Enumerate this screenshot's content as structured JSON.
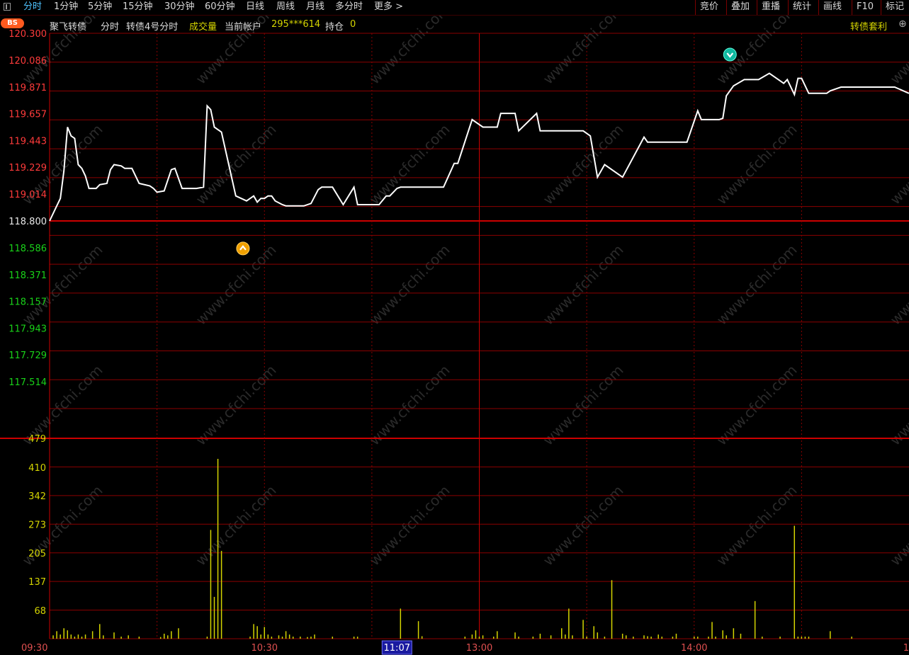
{
  "toolbar": {
    "tabs": [
      "分时",
      "1分钟",
      "5分钟",
      "15分钟",
      "30分钟",
      "60分钟",
      "日线",
      "周线",
      "月线",
      "多分时",
      "更多 >"
    ],
    "active_tab": "分时",
    "right_buttons": [
      "竞价",
      "叠加",
      "重播",
      "统计",
      "画线",
      "F10",
      "标记"
    ]
  },
  "infobar": {
    "badge": "BS",
    "stock_name": "聚飞转债",
    "mode": "分时",
    "layout": "转债4号分时",
    "volume_label": "成交量",
    "account_label": "当前帐户",
    "account_id": "295***614",
    "position_label": "持仓",
    "position_value": "0",
    "arbitrage": "转债套利"
  },
  "colors": {
    "background": "#000000",
    "grid": "#8b0000",
    "price_line": "#ffffff",
    "up_label": "#ff3b3b",
    "down_label": "#19d219",
    "volume_bar": "#d4d400",
    "active_tab": "#4fc3ff"
  },
  "watermark": "www.cfchi.com",
  "chart_data": [
    {
      "type": "line",
      "name": "price",
      "prev_close": 118.8,
      "ylim": [
        117.3,
        120.3
      ],
      "y_tick_labels_up": [
        "120.300",
        "120.086",
        "119.871",
        "119.657",
        "119.443",
        "119.229",
        "119.014"
      ],
      "y_tick_mid": "118.800",
      "y_tick_labels_down": [
        "118.586",
        "118.371",
        "118.157",
        "117.943",
        "117.729",
        "117.514"
      ],
      "x_tick_labels": [
        "09:30",
        "10:30",
        "11:07",
        "13:00",
        "14:00",
        "1"
      ],
      "x_total_minutes": 240,
      "x": [
        0,
        2,
        3,
        4,
        5,
        6,
        7,
        8,
        9,
        10,
        11,
        13,
        14,
        16,
        17,
        18,
        20,
        21,
        23,
        25,
        28,
        29,
        30,
        32,
        34,
        35,
        37,
        39,
        41,
        43,
        44,
        45,
        46,
        48,
        52,
        55,
        57,
        58,
        59,
        60,
        61,
        62,
        63,
        65,
        66,
        68,
        71,
        73,
        75,
        76,
        79,
        82,
        85,
        86,
        87,
        88,
        92,
        94,
        95,
        96,
        97,
        98,
        100,
        102,
        106,
        110,
        113,
        114,
        118,
        121,
        125,
        126,
        130,
        131,
        136,
        137,
        139,
        141,
        143,
        146,
        149,
        151,
        153,
        155,
        160,
        166,
        167,
        170,
        172,
        174,
        178,
        181,
        182,
        186,
        187,
        188,
        189,
        191,
        194,
        198,
        201,
        204,
        205,
        206,
        208,
        209,
        210,
        212,
        213,
        216,
        217,
        218,
        221,
        222,
        224,
        226,
        230,
        236,
        240
      ],
      "y": [
        118.8,
        118.92,
        118.98,
        119.2,
        119.55,
        119.48,
        119.46,
        119.25,
        119.22,
        119.16,
        119.06,
        119.06,
        119.09,
        119.1,
        119.21,
        119.25,
        119.24,
        119.22,
        119.22,
        119.1,
        119.08,
        119.06,
        119.03,
        119.04,
        119.21,
        119.22,
        119.06,
        119.06,
        119.06,
        119.07,
        119.72,
        119.69,
        119.55,
        119.51,
        119.0,
        118.96,
        119.0,
        118.95,
        118.98,
        118.98,
        119.0,
        119.0,
        118.96,
        118.93,
        118.92,
        118.92,
        118.92,
        118.94,
        119.05,
        119.07,
        119.07,
        118.93,
        119.07,
        118.93,
        118.93,
        118.93,
        118.93,
        119.0,
        119.0,
        119.03,
        119.06,
        119.07,
        119.07,
        119.07,
        119.07,
        119.07,
        119.26,
        119.26,
        119.61,
        119.55,
        119.55,
        119.66,
        119.66,
        119.52,
        119.66,
        119.52,
        119.52,
        119.52,
        119.52,
        119.52,
        119.52,
        119.48,
        119.15,
        119.25,
        119.15,
        119.47,
        119.43,
        119.43,
        119.43,
        119.43,
        119.43,
        119.68,
        119.61,
        119.61,
        119.61,
        119.62,
        119.8,
        119.88,
        119.93,
        119.93,
        119.98,
        119.92,
        119.9,
        119.93,
        119.81,
        119.94,
        119.94,
        119.82,
        119.82,
        119.82,
        119.82,
        119.84,
        119.87,
        119.87,
        119.87,
        119.87,
        119.87,
        119.87,
        119.82
      ],
      "markers": [
        {
          "kind": "buy",
          "x": 54,
          "y": 118.58
        },
        {
          "kind": "sell",
          "x": 190,
          "y": 120.13
        }
      ]
    },
    {
      "type": "bar",
      "name": "volume",
      "ylim": [
        0,
        479
      ],
      "y_tick_labels": [
        "479",
        "410",
        "342",
        "273",
        "205",
        "137",
        "68"
      ],
      "x": [
        1,
        2,
        3,
        4,
        5,
        6,
        7,
        8,
        9,
        10,
        12,
        14,
        15,
        18,
        20,
        22,
        25,
        31,
        32,
        33,
        34,
        36,
        44,
        45,
        46,
        47,
        48,
        56,
        57,
        58,
        59,
        60,
        61,
        62,
        64,
        65,
        66,
        67,
        68,
        70,
        72,
        73,
        74,
        79,
        85,
        86,
        98,
        103,
        104,
        116,
        118,
        119,
        120,
        121,
        124,
        125,
        130,
        131,
        135,
        137,
        140,
        143,
        144,
        145,
        146,
        149,
        150,
        152,
        153,
        155,
        157,
        160,
        161,
        163,
        166,
        167,
        168,
        170,
        171,
        174,
        175,
        180,
        181,
        184,
        185,
        186,
        188,
        189,
        191,
        193,
        197,
        199,
        204,
        208,
        209,
        210,
        211,
        212,
        218,
        224
      ],
      "values": [
        8,
        18,
        10,
        25,
        20,
        10,
        5,
        10,
        5,
        10,
        18,
        35,
        8,
        15,
        5,
        8,
        5,
        4,
        12,
        8,
        18,
        25,
        5,
        260,
        100,
        430,
        210,
        5,
        35,
        30,
        10,
        28,
        10,
        5,
        8,
        5,
        18,
        10,
        5,
        5,
        4,
        5,
        10,
        5,
        5,
        5,
        72,
        42,
        6,
        5,
        10,
        20,
        5,
        8,
        5,
        18,
        15,
        5,
        5,
        12,
        8,
        25,
        10,
        72,
        8,
        45,
        5,
        30,
        15,
        5,
        140,
        12,
        8,
        5,
        8,
        6,
        5,
        10,
        5,
        5,
        12,
        5,
        5,
        5,
        40,
        5,
        20,
        8,
        25,
        12,
        90,
        5,
        5,
        270,
        5,
        5,
        5,
        5,
        18,
        5
      ]
    }
  ]
}
